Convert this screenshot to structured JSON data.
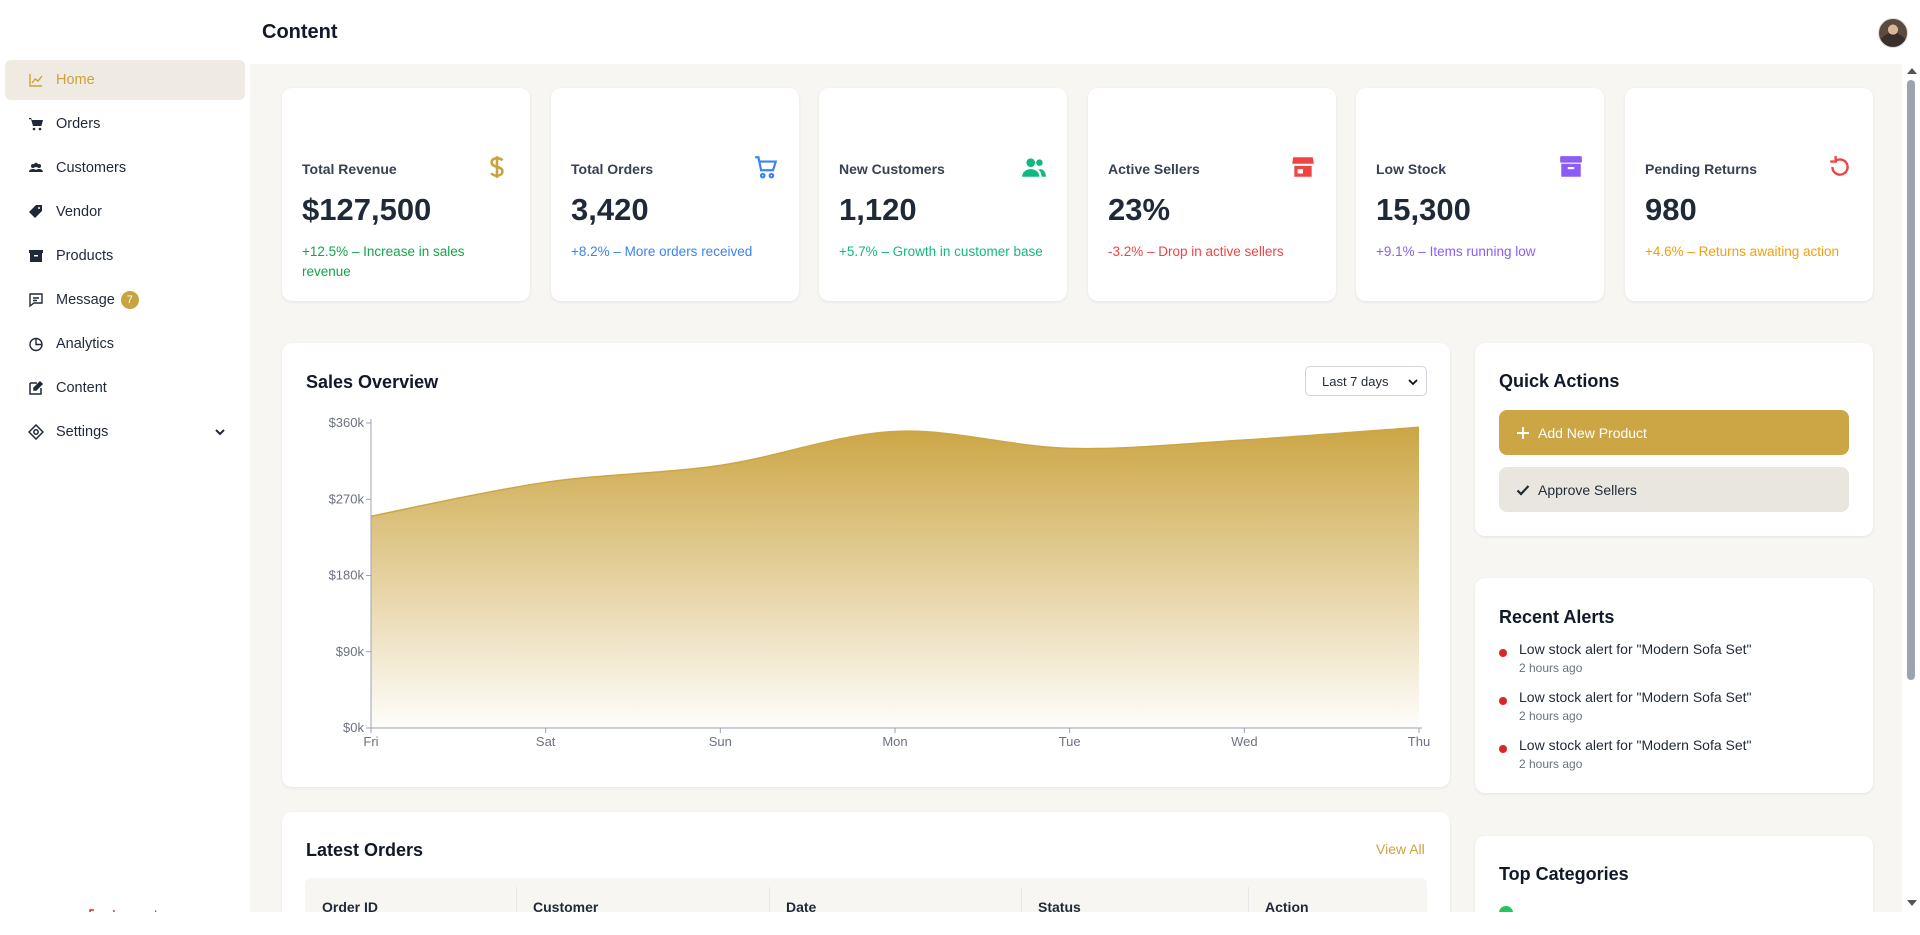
{
  "header": {
    "title": "Content"
  },
  "sidebar": {
    "items": [
      {
        "label": "Home",
        "icon": "chart-line-icon",
        "active": true
      },
      {
        "label": "Orders",
        "icon": "cart-icon"
      },
      {
        "label": "Customers",
        "icon": "users-icon"
      },
      {
        "label": "Vendor",
        "icon": "tag-icon"
      },
      {
        "label": "Products",
        "icon": "box-icon"
      },
      {
        "label": "Message",
        "icon": "message-icon",
        "badge": "7"
      },
      {
        "label": "Analytics",
        "icon": "pie-chart-icon"
      },
      {
        "label": "Content",
        "icon": "edit-icon"
      },
      {
        "label": "Settings",
        "icon": "settings-icon"
      }
    ],
    "logout": "Logout"
  },
  "stats": [
    {
      "label": "Total Revenue",
      "value": "$127,500",
      "change": "+12.5% – Increase in sales revenue",
      "color": "#16a34a",
      "icon": "dollar-icon",
      "icon_color": "#c9a33f"
    },
    {
      "label": "Total Orders",
      "value": "3,420",
      "change": "+8.2% – More orders received",
      "color": "#3b82f6",
      "icon": "cart-icon",
      "icon_color": "#3b82f6"
    },
    {
      "label": "New Customers",
      "value": "1,120",
      "change": "+5.7% – Growth in customer base",
      "color": "#10b981",
      "icon": "users-icon",
      "icon_color": "#10b981"
    },
    {
      "label": "Active Sellers",
      "value": "23%",
      "change": "-3.2% – Drop in active sellers",
      "color": "#ef4444",
      "icon": "store-icon",
      "icon_color": "#ef4444"
    },
    {
      "label": "Low Stock",
      "value": "15,300",
      "change": "+9.1% – Items running low",
      "color": "#8b5cf6",
      "icon": "archive-icon",
      "icon_color": "#8b5cf6"
    },
    {
      "label": "Pending Returns",
      "value": "980",
      "change": "+4.6% – Returns awaiting action",
      "color": "#f59e0b",
      "icon": "refresh-icon",
      "icon_color": "#ef4444"
    }
  ],
  "sales": {
    "title": "Sales Overview",
    "range": "Last 7 days"
  },
  "chart_data": {
    "type": "area",
    "categories": [
      "Fri",
      "Sat",
      "Sun",
      "Mon",
      "Tue",
      "Wed",
      "Thu"
    ],
    "values": [
      250,
      290,
      310,
      350,
      330,
      340,
      355
    ],
    "y_ticks": [
      "$0k",
      "$90k",
      "$180k",
      "$270k",
      "$360k"
    ],
    "ylim": [
      0,
      360
    ],
    "color": "#cca645"
  },
  "quick_actions": {
    "title": "Quick Actions",
    "add_product": "Add New Product",
    "approve_sellers": "Approve Sellers"
  },
  "alerts": {
    "title": "Recent Alerts",
    "items": [
      {
        "text": "Low stock alert for \"Modern Sofa Set\"",
        "time": "2 hours ago"
      },
      {
        "text": "Low stock alert for \"Modern Sofa Set\"",
        "time": "2 hours ago"
      },
      {
        "text": "Low stock alert for \"Modern Sofa Set\"",
        "time": "2 hours ago"
      }
    ]
  },
  "orders": {
    "title": "Latest Orders",
    "view_all": "View All",
    "columns": [
      "Order ID",
      "Customer",
      "Date",
      "Status",
      "Action"
    ]
  },
  "categories": {
    "title": "Top Categories"
  }
}
